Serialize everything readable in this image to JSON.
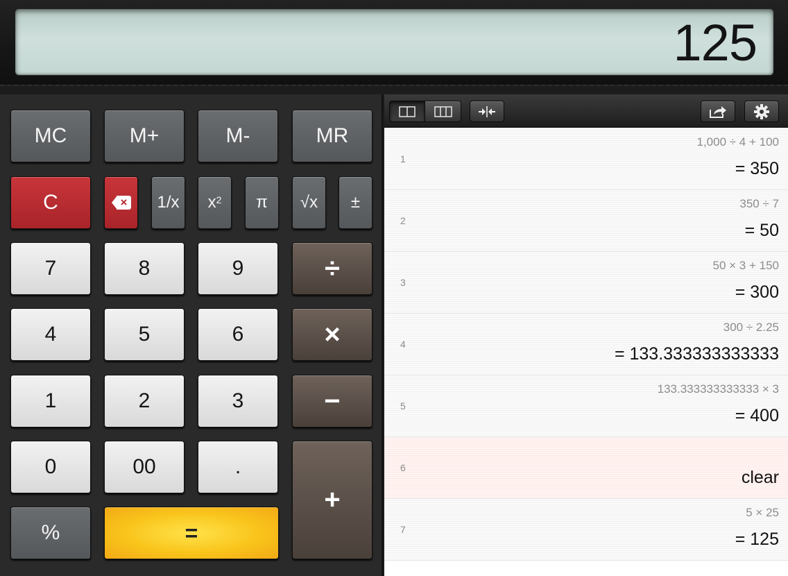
{
  "display": {
    "value": "125"
  },
  "memory_keys": [
    "MC",
    "M+",
    "M-",
    "MR"
  ],
  "function_keys": {
    "clear": "C",
    "reciprocal": "1/x",
    "square_base": "x",
    "square_exp": "2",
    "pi": "π",
    "sqrt": "√x",
    "plus_minus": "±"
  },
  "digits": {
    "seven": "7",
    "eight": "8",
    "nine": "9",
    "four": "4",
    "five": "5",
    "six": "6",
    "one": "1",
    "two": "2",
    "three": "3",
    "zero": "0",
    "double_zero": "00",
    "decimal": "."
  },
  "operators": {
    "divide": "÷",
    "multiply": "×",
    "minus": "−",
    "plus": "+",
    "equals": "=",
    "percent": "%"
  },
  "icons": {
    "backspace": "backspace-icon",
    "two_column": "two-column-icon",
    "three_column": "three-column-icon",
    "collapse": "collapse-icon",
    "share": "share-icon",
    "settings": "gear-icon"
  },
  "history": [
    {
      "index": "1",
      "expression": "1,000 ÷ 4 + 100",
      "result": "= 350"
    },
    {
      "index": "2",
      "expression": "350 ÷ 7",
      "result": "= 50"
    },
    {
      "index": "3",
      "expression": "50 × 3 + 150",
      "result": "= 300"
    },
    {
      "index": "4",
      "expression": "300 ÷ 2.25",
      "result": "= 133.333333333333"
    },
    {
      "index": "5",
      "expression": "133.333333333333 × 3",
      "result": "= 400"
    },
    {
      "index": "6",
      "expression": "",
      "result": "clear"
    },
    {
      "index": "7",
      "expression": "5 × 25",
      "result": "= 125"
    }
  ],
  "colors": {
    "accent_red": "#b8272c",
    "equals_yellow": "#f9c41b",
    "operator_brown": "#5c514a"
  }
}
